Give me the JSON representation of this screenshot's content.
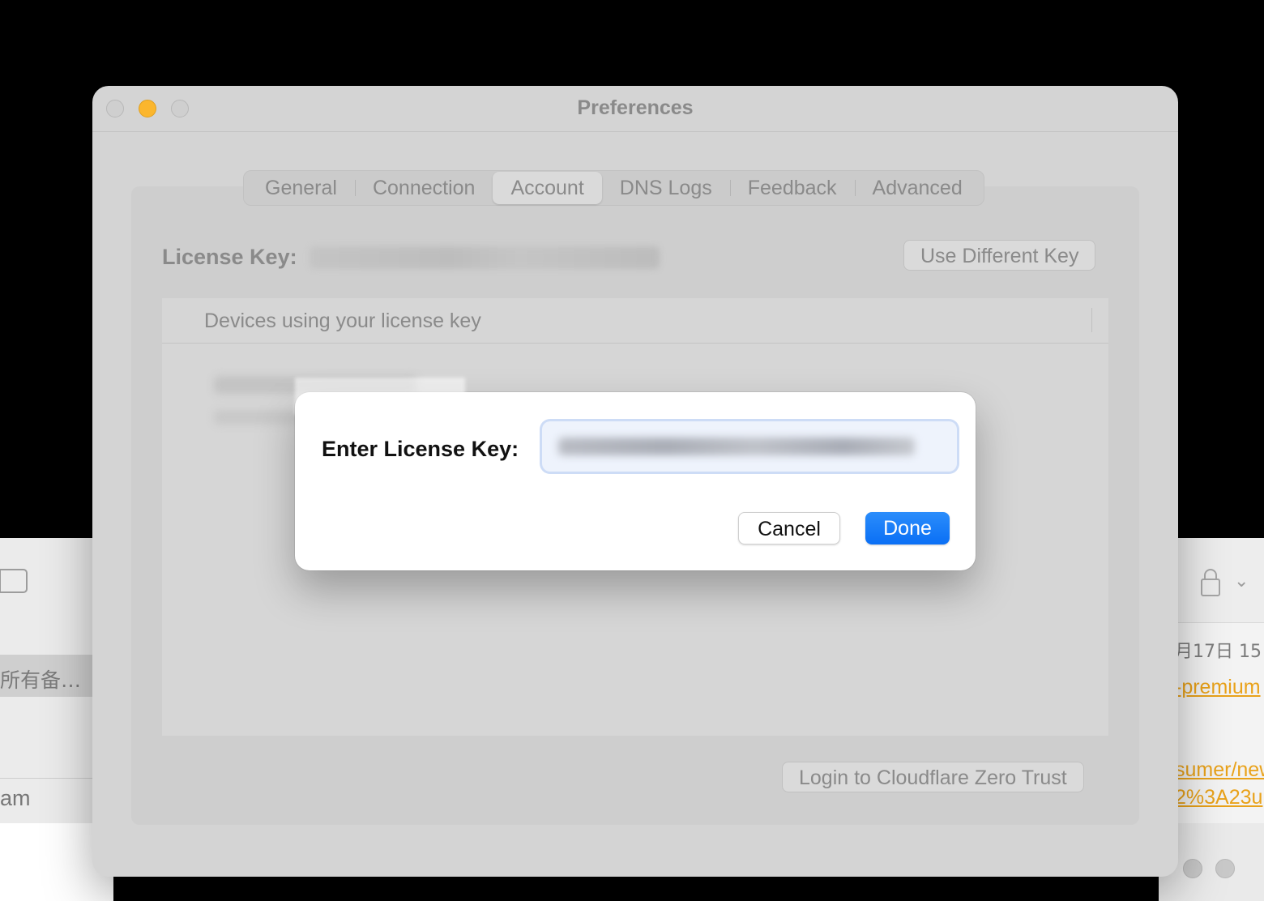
{
  "background": {
    "left_window": {
      "selected_row": "所有备…",
      "row_label": "am"
    },
    "right_window": {
      "date_text": "月17日 15",
      "link_1": "-premium",
      "link_2": "sumer/new",
      "link_3": "2%3A23u"
    }
  },
  "window": {
    "title": "Preferences"
  },
  "tabs": [
    {
      "label": "General",
      "active": false
    },
    {
      "label": "Connection",
      "active": false
    },
    {
      "label": "Account",
      "active": true
    },
    {
      "label": "DNS Logs",
      "active": false
    },
    {
      "label": "Feedback",
      "active": false
    },
    {
      "label": "Advanced",
      "active": false
    }
  ],
  "account": {
    "license_label": "License Key:",
    "use_different_key_label": "Use Different Key",
    "devices_header": "Devices using your license key",
    "login_button_label": "Login to Cloudflare Zero Trust"
  },
  "sheet": {
    "label": "Enter License Key:",
    "cancel_label": "Cancel",
    "done_label": "Done"
  },
  "colors": {
    "accent": "#0a6ff5",
    "minimize": "#fbb62d",
    "link": "#e9a21a"
  }
}
